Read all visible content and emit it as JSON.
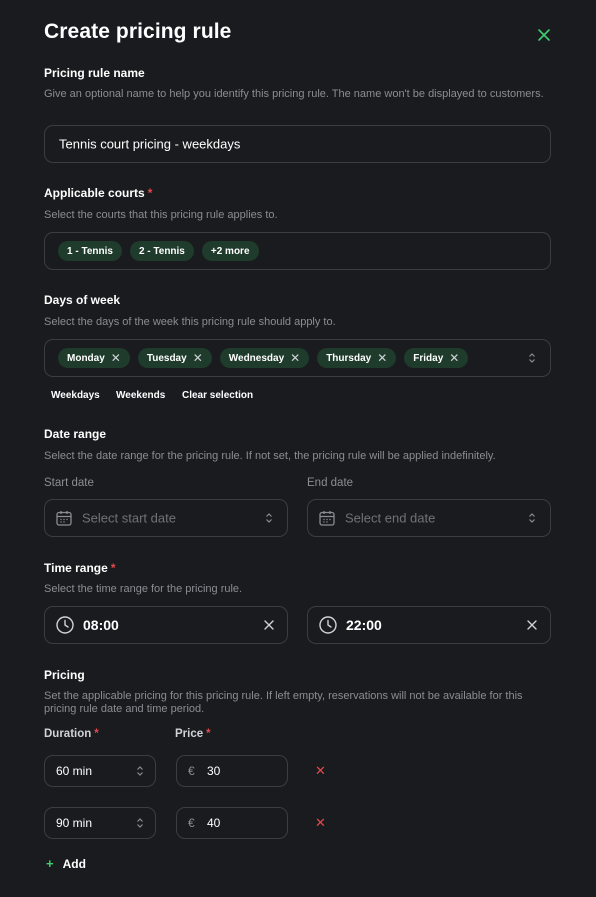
{
  "title": "Create pricing rule",
  "rule_name": {
    "label": "Pricing rule name",
    "help": "Give an optional name to help you identify this pricing rule. The name won't be displayed to customers.",
    "value": "Tennis court pricing - weekdays"
  },
  "courts": {
    "label": "Applicable courts",
    "required_mark": "*",
    "help": "Select the courts that this pricing rule applies to.",
    "chips": [
      "1 - Tennis",
      "2 - Tennis",
      "+2 more"
    ]
  },
  "days": {
    "label": "Days of week",
    "help": "Select the days of the week this pricing rule should apply to.",
    "chips": [
      "Monday",
      "Tuesday",
      "Wednesday",
      "Thursday",
      "Friday"
    ],
    "quick": [
      "Weekdays",
      "Weekends",
      "Clear selection"
    ]
  },
  "date_range": {
    "label": "Date range",
    "help": "Select the date range for the pricing rule. If not set, the pricing rule will be applied indefinitely.",
    "start_label": "Start date",
    "start_placeholder": "Select start date",
    "end_label": "End date",
    "end_placeholder": "Select end date"
  },
  "time_range": {
    "label": "Time range",
    "required_mark": "*",
    "help": "Select the time range for the pricing rule.",
    "start": "08:00",
    "end": "22:00"
  },
  "pricing": {
    "label": "Pricing",
    "help": "Set the applicable pricing for this pricing rule. If left empty, reservations will not be available for this pricing rule date and time period.",
    "duration_label": "Duration",
    "price_label": "Price",
    "required_mark": "*",
    "currency": "€",
    "rows": [
      {
        "duration": "60 min",
        "price": "30"
      },
      {
        "duration": "90 min",
        "price": "40"
      }
    ],
    "add_label": "Add"
  },
  "colors": {
    "background": "#1a1b1e",
    "accent": "#3ecf72",
    "chip_bg": "#1f3b2c",
    "danger": "#e5484d",
    "border": "#3c3d42"
  }
}
